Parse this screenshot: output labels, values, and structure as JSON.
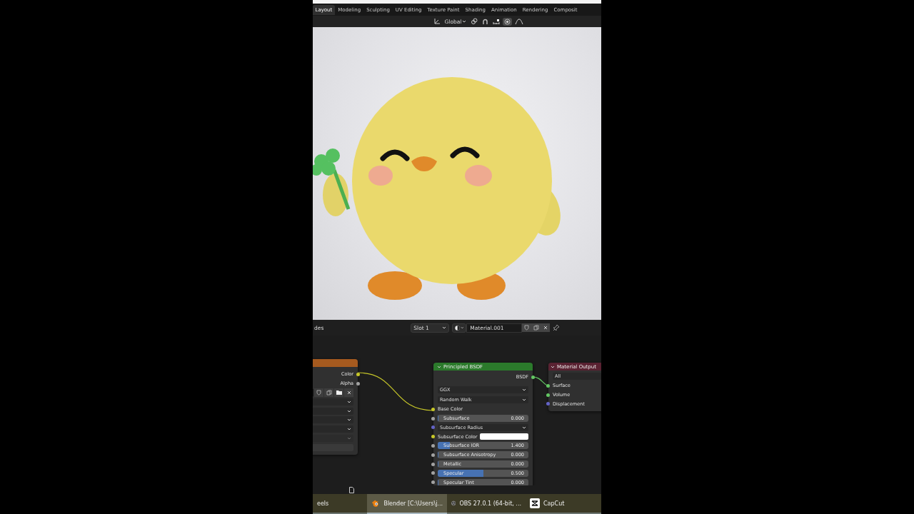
{
  "workspace_tabs": [
    {
      "label": "Layout",
      "selected": true
    },
    {
      "label": "Modeling",
      "selected": false
    },
    {
      "label": "Sculpting",
      "selected": false
    },
    {
      "label": "UV Editing",
      "selected": false
    },
    {
      "label": "Texture Paint",
      "selected": false
    },
    {
      "label": "Shading",
      "selected": false
    },
    {
      "label": "Animation",
      "selected": false
    },
    {
      "label": "Rendering",
      "selected": false
    },
    {
      "label": "Composit",
      "selected": false
    }
  ],
  "viewport_header": {
    "orientation": "Global",
    "snap_on": false,
    "proportional_on": true
  },
  "node_header": {
    "editor_label": "des",
    "slot": "Slot 1",
    "material": "Material.001"
  },
  "nodes": [
    {
      "kind": "texture",
      "outputs": [
        {
          "label": "Color",
          "color": "#c7c729"
        },
        {
          "label": "Alpha",
          "color": "#a1a1a1"
        }
      ],
      "fields": [
        {
          "kind": "image"
        },
        {
          "kind": "dropdown",
          "disabled": false
        },
        {
          "kind": "dropdown",
          "disabled": false
        },
        {
          "kind": "dropdown",
          "disabled": false
        },
        {
          "kind": "dropdown",
          "disabled": false
        },
        {
          "kind": "dropdown",
          "disabled": true
        },
        {
          "kind": "value"
        }
      ]
    },
    {
      "kind": "shader",
      "title": "Principled BSDF",
      "output": {
        "label": "BSDF",
        "color": "#63c763"
      },
      "dropdowns": [
        "GGX",
        "Random Walk"
      ],
      "inputs": [
        {
          "kind": "label",
          "label": "Base Color",
          "color": "#c7c729"
        },
        {
          "kind": "slider",
          "label": "Subsurface",
          "value": "0.000",
          "level": 0,
          "color": "#a1a1a1"
        },
        {
          "kind": "dropdown",
          "label": "Subsurface Radius",
          "color": "#6363c7"
        },
        {
          "kind": "swatch",
          "label": "Subsurface Color",
          "color": "#c7c729",
          "swatch": {
            "color": "#ffffff"
          }
        },
        {
          "kind": "slider",
          "label": "Subsurface IOR",
          "value": "1.400",
          "level": 0.13,
          "color": "#a1a1a1"
        },
        {
          "kind": "slider",
          "label": "Subsurface Anisotropy",
          "value": "0.000",
          "level": 0,
          "color": "#a1a1a1"
        },
        {
          "kind": "slider",
          "label": "Metallic",
          "value": "0.000",
          "level": 0,
          "color": "#a1a1a1"
        },
        {
          "kind": "slider",
          "label": "Specular",
          "value": "0.500",
          "level": 0.5,
          "color": "#a1a1a1"
        },
        {
          "kind": "slider",
          "label": "Specular Tint",
          "value": "0.000",
          "level": 0,
          "color": "#a1a1a1"
        }
      ]
    },
    {
      "kind": "output",
      "title": "Material Output",
      "target": "All",
      "inputs": [
        {
          "label": "Surface",
          "color": "#63c763"
        },
        {
          "label": "Volume",
          "color": "#63c763"
        },
        {
          "label": "Displacement",
          "color": "#6363c7"
        }
      ]
    }
  ],
  "taskbar": [
    {
      "kind": "plain",
      "label": "eels",
      "selected": false
    },
    {
      "kind": "blender",
      "label": "Blender [C:\\Users\\j...",
      "selected": true
    },
    {
      "kind": "obs",
      "label": "OBS 27.0.1 (64-bit, ...",
      "selected": false
    },
    {
      "kind": "capcut",
      "label": "CapCut",
      "selected": false
    }
  ]
}
